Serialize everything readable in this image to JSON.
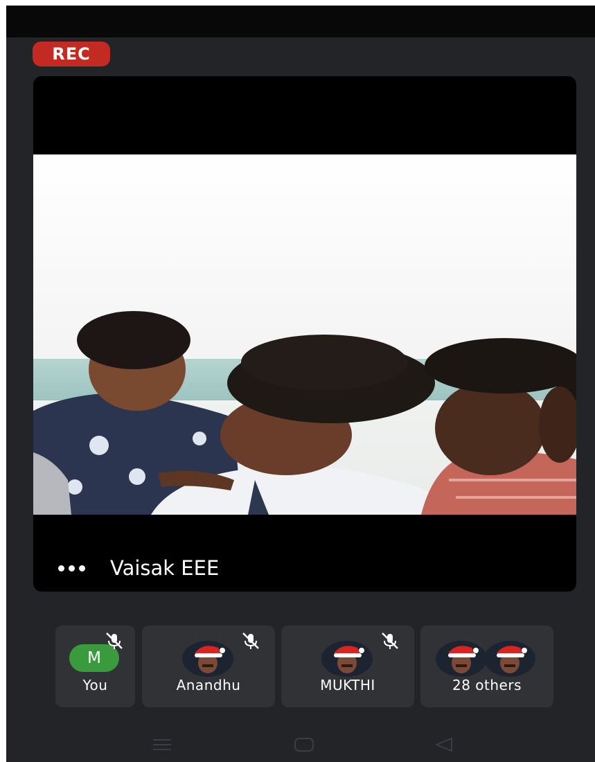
{
  "recording": {
    "badge": "REC"
  },
  "main_tile": {
    "speaker": "Vaisak EEE",
    "more_icon": "more-horizontal-icon"
  },
  "participants": [
    {
      "name": "You",
      "avatar_initial": "M",
      "avatar_color": "#3a9b3c",
      "muted": true
    },
    {
      "name": "Anandhu",
      "avatar": "photo",
      "muted": true
    },
    {
      "name": "MUKTHI",
      "avatar": "photo",
      "muted": true
    },
    {
      "name": "28 others",
      "avatar": "photo-stack",
      "muted": false
    }
  ],
  "nav": {
    "icons": [
      "menu-lines-icon",
      "home-square-icon",
      "back-triangle-icon"
    ]
  },
  "colors": {
    "background": "#222427",
    "tile": "#303236",
    "rec": "#c22a22",
    "avatar_green": "#3a9b3c"
  }
}
